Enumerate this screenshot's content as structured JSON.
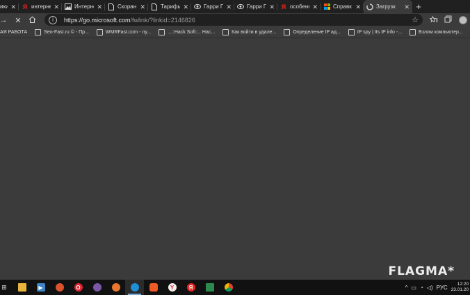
{
  "tabs": [
    {
      "title": "ики",
      "icon": "page-icon",
      "active": false
    },
    {
      "title": "интерне",
      "icon": "yandex-icon",
      "active": false
    },
    {
      "title": "Интерне",
      "icon": "image-icon",
      "active": false
    },
    {
      "title": "Скоран",
      "icon": "page-icon",
      "active": false
    },
    {
      "title": "Тарифы",
      "icon": "page-icon",
      "active": false
    },
    {
      "title": "Гарри П",
      "icon": "eye-icon",
      "active": false
    },
    {
      "title": "Гарри П",
      "icon": "eye-icon",
      "active": false
    },
    {
      "title": "особенн",
      "icon": "yandex-icon",
      "active": false
    },
    {
      "title": "Справк",
      "icon": "microsoft-icon",
      "active": false
    },
    {
      "title": "Загрузк",
      "icon": "loading-icon",
      "active": true
    }
  ],
  "toolbar": {
    "url_host": "https://go.microsoft.com",
    "url_path": "/fwlink/?linkid=2146826"
  },
  "bookmarks": [
    {
      "label": "АЯ РАБОТА"
    },
    {
      "label": "Seo-Fast.ru © - Пр..."
    },
    {
      "label": "WMRFast.com - лу..."
    },
    {
      "label": "...::Hack Soft::.. Нас..."
    },
    {
      "label": "Как войти в удале..."
    },
    {
      "label": "Определение IP ад..."
    },
    {
      "label": "IP spy | Its IP info -..."
    },
    {
      "label": "Взлом компьютер..."
    }
  ],
  "watermark": "FLAGMA*",
  "taskbar": {
    "apps": [
      {
        "name": "file-explorer-icon",
        "color": "#e8b43c",
        "glyph": ""
      },
      {
        "name": "media-player-icon",
        "color": "#3a86c8",
        "glyph": "▶"
      },
      {
        "name": "ccleaner-icon",
        "color": "#d9532c",
        "glyph": ""
      },
      {
        "name": "opera-icon",
        "color": "#e0242f",
        "glyph": "O"
      },
      {
        "name": "viber-icon",
        "color": "#7b57a8",
        "glyph": ""
      },
      {
        "name": "firefox-icon",
        "color": "#e8772e",
        "glyph": ""
      },
      {
        "name": "edge-icon",
        "color": "#1f8fd6",
        "glyph": ""
      },
      {
        "name": "brave-icon",
        "color": "#f05a24",
        "glyph": ""
      },
      {
        "name": "yandex-browser-icon",
        "color": "#f1f1f1",
        "glyph": "Y"
      },
      {
        "name": "yandex-icon",
        "color": "#e52620",
        "glyph": "Я"
      },
      {
        "name": "spreadsheet-icon",
        "color": "#2c8a4e",
        "glyph": ""
      },
      {
        "name": "chrome-icon",
        "color": "#dcb131",
        "glyph": ""
      }
    ],
    "language": "РУС",
    "time": "12:20",
    "date": "23.01.20"
  }
}
